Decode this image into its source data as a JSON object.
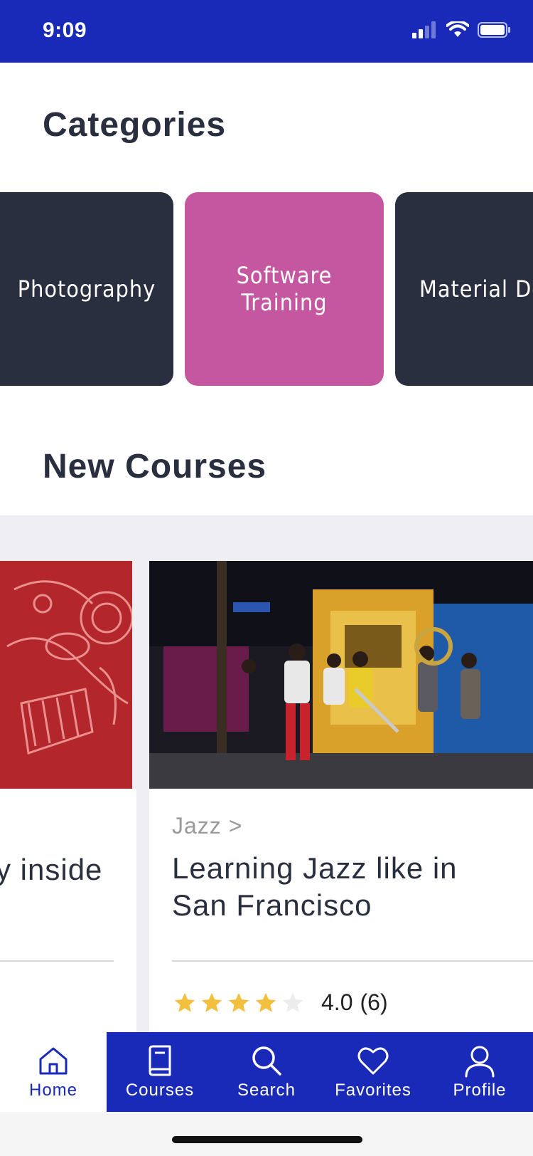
{
  "status": {
    "time": "9:09"
  },
  "categories": {
    "title": "Categories",
    "items": [
      {
        "label": "Photography",
        "color": "#2a2f40"
      },
      {
        "label": "Software\nTraining",
        "color": "#c4579f"
      },
      {
        "label": "Material Des",
        "color": "#2a2f40"
      }
    ]
  },
  "new_courses": {
    "title": "New Courses",
    "items": [
      {
        "title_fragment": "y inside"
      },
      {
        "category": "Jazz >",
        "title": "Learning Jazz like in San Francisco",
        "rating_value": "4.0",
        "rating_count": "(6)",
        "stars": 4
      }
    ]
  },
  "tabbar": {
    "tabs": [
      {
        "label": "Home",
        "icon": "home-icon",
        "active": true
      },
      {
        "label": "Courses",
        "icon": "book-icon"
      },
      {
        "label": "Search",
        "icon": "search-icon"
      },
      {
        "label": "Favorites",
        "icon": "heart-icon"
      },
      {
        "label": "Profile",
        "icon": "user-icon"
      }
    ]
  },
  "colors": {
    "primary": "#1a2ab8",
    "dark_card": "#2a2f40",
    "pink_card": "#c4579f",
    "star": "#f2c03e"
  }
}
